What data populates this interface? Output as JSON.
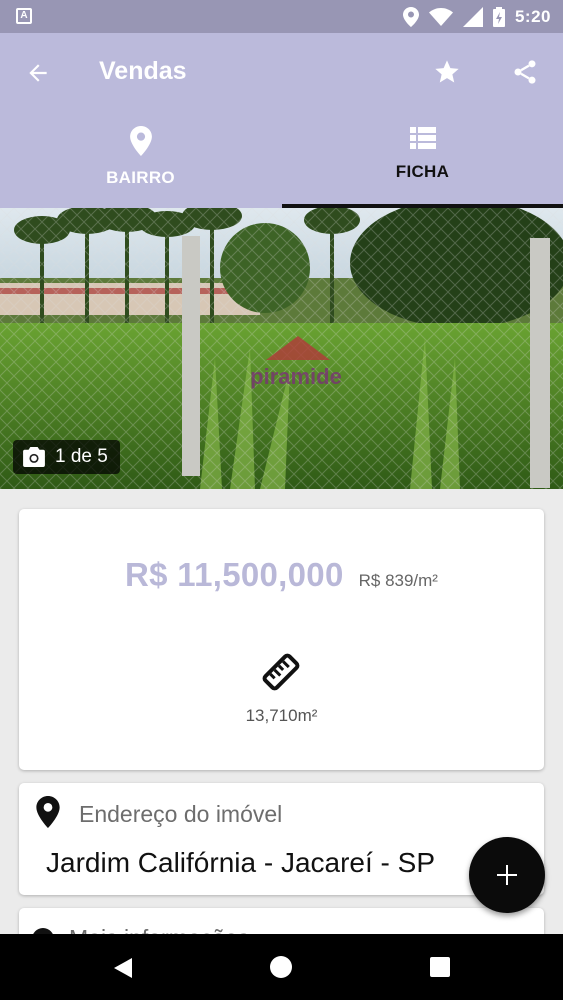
{
  "status_bar": {
    "time": "5:20",
    "left_badge": "A",
    "icons": [
      "location-icon",
      "wifi-icon",
      "signal-icon",
      "battery-icon"
    ]
  },
  "app_bar": {
    "title": "Vendas",
    "icons": [
      "back-arrow-icon",
      "star-icon",
      "share-icon"
    ]
  },
  "tabs": [
    {
      "label": "BAIRRO",
      "icon": "map-pin-icon",
      "selected": false
    },
    {
      "label": "FICHA",
      "icon": "list-icon",
      "selected": true
    }
  ],
  "photo": {
    "counter": "1 de 5",
    "watermark": "piramide"
  },
  "listing": {
    "price": "R$ 11,500,000",
    "price_per_m2": "R$ 839/m²",
    "area": "13,710m²"
  },
  "address": {
    "label": "Endereço do imóvel",
    "value": "Jardim Califórnia - Jacareí - SP"
  },
  "more_info": {
    "label": "Mais informações"
  },
  "colors": {
    "status_bar": "#9896b4",
    "app_bar": "#bbbadb",
    "price": "#b9b8d8",
    "fab": "#0b0b0b"
  }
}
